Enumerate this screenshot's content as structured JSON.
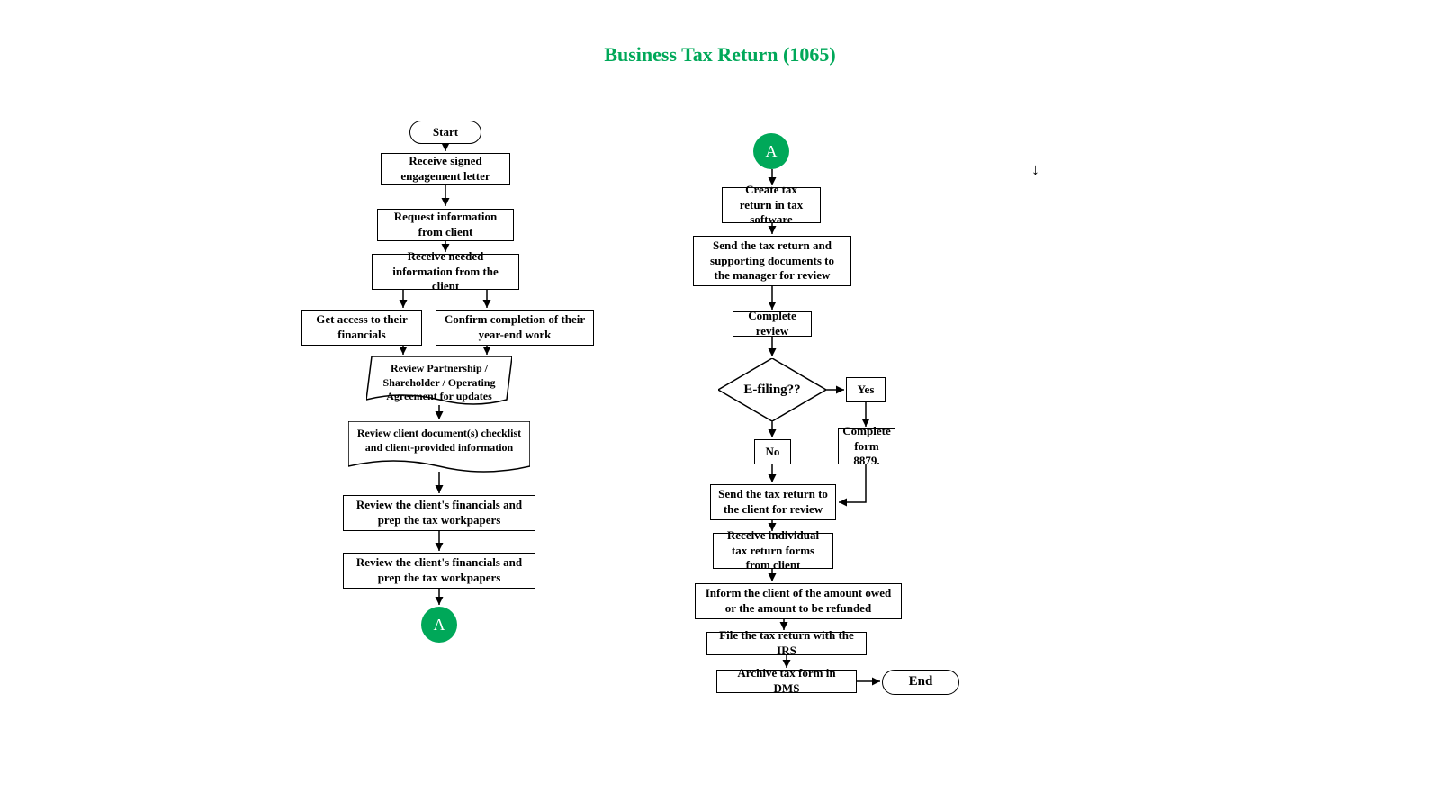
{
  "title": "Business Tax Return (1065)",
  "start": "Start",
  "end": "End",
  "connectorA": "A",
  "left": {
    "n1": "Receive signed engagement letter",
    "n2": "Request information from client",
    "n3": "Receive needed information from the client",
    "n4": "Get access to their financials",
    "n5": "Confirm completion of their year-end work",
    "doc1": "Review Partnership / Shareholder / Operating Agreement for updates",
    "doc2": "Review client document(s) checklist and client-provided information",
    "n6": "Review the client's financials and prep the tax workpapers",
    "n7": "Review the client's financials and prep the tax workpapers"
  },
  "right": {
    "n1": "Create tax return in tax software",
    "n2": "Send the tax return and supporting documents to the manager for review",
    "n3": "Complete review",
    "decision": "E-filing??",
    "yes": "Yes",
    "no": "No",
    "n4": "Complete form 8879.",
    "n5": "Send the tax return to the client for review",
    "n6": "Receive individual tax return forms from client",
    "n7": "Inform the client of the amount owed or the amount to be refunded",
    "n8": "File the tax return with the IRS",
    "n9": "Archive tax form in DMS"
  },
  "stray": "↓"
}
